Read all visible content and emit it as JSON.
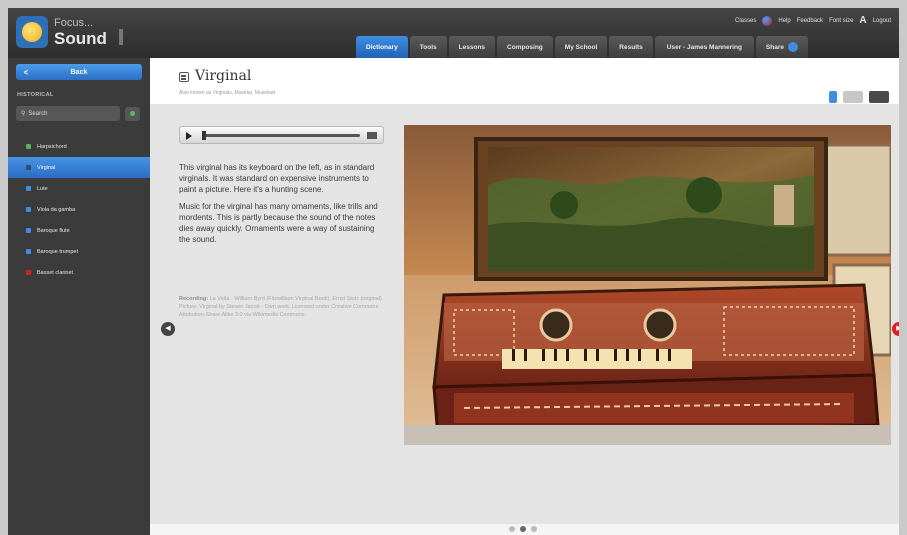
{
  "app": {
    "logo_line1": "Focus...",
    "logo_line2": "Sound"
  },
  "util_links": [
    "Classes",
    "Help",
    "Feedback",
    "Font size",
    "A",
    "Logout"
  ],
  "nav_tabs": [
    {
      "label": "Dictionary",
      "active": true
    },
    {
      "label": "Tools",
      "active": false
    },
    {
      "label": "Lessons",
      "active": false
    },
    {
      "label": "Composing",
      "active": false
    },
    {
      "label": "My School",
      "active": false
    },
    {
      "label": "Results",
      "active": false
    },
    {
      "label": "User - James Mannering",
      "active": false
    },
    {
      "label": "Share",
      "active": false
    }
  ],
  "sidebar": {
    "back_label": "Back",
    "section": "HISTORICAL",
    "search_placeholder": "Search",
    "items": [
      {
        "label": "Harpsichord",
        "color": "#5ab05a",
        "active": false
      },
      {
        "label": "Virginal",
        "color": "#3a4a6a",
        "active": true
      },
      {
        "label": "Lute",
        "color": "#3f8ee0",
        "active": false
      },
      {
        "label": "Viola da gamba",
        "color": "#3f8ee0",
        "active": false
      },
      {
        "label": "Baroque flute",
        "color": "#3f8ee0",
        "active": false
      },
      {
        "label": "Baroque trumpet",
        "color": "#3f8ee0",
        "active": false
      },
      {
        "label": "Basset clarinet",
        "color": "#d02020",
        "active": false
      }
    ]
  },
  "main": {
    "title": "Virginal",
    "subtitle": "Also known as Virginals, Muselar, Muselaar",
    "description": [
      "This virginal has its keyboard on the left, as in standard virginals. It was standard on expensive instruments to paint a picture. Here it's a hunting scene.",
      "Music for the virginal has many ornaments, like trills and mordents. This is partly because the sound of the notes dies away quickly. Ornaments were a way of sustaining the sound."
    ],
    "credits_label": "Recording:",
    "credits_text": "La Volta - William Byrd (Fitzwilliam Virginal Book). Ernst Stolz (original) Picture: Virginal by Steven Jacob - Own work. Licensed under Creative Commons Attribution-Share Alike 3.0 via Wikimedia Commons"
  },
  "pager": {
    "count": 3,
    "current": 1
  }
}
